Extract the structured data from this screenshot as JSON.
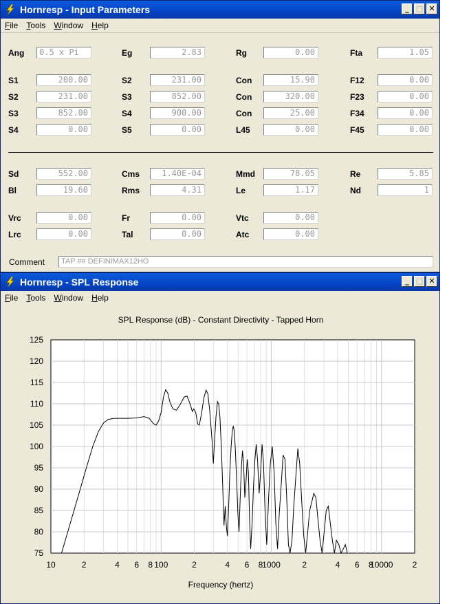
{
  "window1": {
    "title": "Hornresp - Input Parameters",
    "controls": {
      "minimize": "_",
      "maximize": "□",
      "close": "✕"
    },
    "menu": [
      "File",
      "Tools",
      "Window",
      "Help"
    ]
  },
  "params": {
    "ang": {
      "label": "Ang",
      "value": "0.5 x Pi"
    },
    "eg": {
      "label": "Eg",
      "value": "2.83"
    },
    "rg": {
      "label": "Rg",
      "value": "0.00"
    },
    "fta": {
      "label": "Fta",
      "value": "1.05"
    },
    "r1": [
      {
        "label": "S1",
        "value": "200.00"
      },
      {
        "label": "S2",
        "value": "231.00"
      },
      {
        "label": "Con",
        "value": "15.90"
      },
      {
        "label": "F12",
        "value": "0.00"
      }
    ],
    "r2": [
      {
        "label": "S2",
        "value": "231.00"
      },
      {
        "label": "S3",
        "value": "852.00"
      },
      {
        "label": "Con",
        "value": "320.00"
      },
      {
        "label": "F23",
        "value": "0.00"
      }
    ],
    "r3": [
      {
        "label": "S3",
        "value": "852.00"
      },
      {
        "label": "S4",
        "value": "900.00"
      },
      {
        "label": "Con",
        "value": "25.00"
      },
      {
        "label": "F34",
        "value": "0.00"
      }
    ],
    "r4": [
      {
        "label": "S4",
        "value": "0.00"
      },
      {
        "label": "S5",
        "value": "0.00"
      },
      {
        "label": "L45",
        "value": "0.00"
      },
      {
        "label": "F45",
        "value": "0.00"
      }
    ],
    "d1": [
      {
        "label": "Sd",
        "value": "552.00"
      },
      {
        "label": "Cms",
        "value": "1.40E-04"
      },
      {
        "label": "Mmd",
        "value": "78.05"
      },
      {
        "label": "Re",
        "value": "5.85"
      }
    ],
    "d2": [
      {
        "label": "Bl",
        "value": "19.60"
      },
      {
        "label": "Rms",
        "value": "4.31"
      },
      {
        "label": "Le",
        "value": "1.17"
      },
      {
        "label": "Nd",
        "value": "1"
      }
    ],
    "c1": [
      {
        "label": "Vrc",
        "value": "0.00"
      },
      {
        "label": "Fr",
        "value": "0.00"
      },
      {
        "label": "Vtc",
        "value": "0.00"
      }
    ],
    "c2": [
      {
        "label": "Lrc",
        "value": "0.00"
      },
      {
        "label": "Tal",
        "value": "0.00"
      },
      {
        "label": "Atc",
        "value": "0.00"
      }
    ],
    "comment": {
      "label": "Comment",
      "value": "TAP ## DEFINIMAX12HO"
    }
  },
  "window2": {
    "title": "Hornresp - SPL Response",
    "controls": {
      "minimize": "_",
      "maximize": "□",
      "close": "✕"
    },
    "menu": [
      "File",
      "Tools",
      "Window",
      "Help"
    ]
  },
  "chart_data": {
    "type": "line",
    "title": "SPL Response (dB) - Constant Directivity - Tapped Horn",
    "xlabel": "Frequency (hertz)",
    "ylabel": "",
    "xscale": "log",
    "xlim": [
      10,
      20000
    ],
    "ylim": [
      75,
      125
    ],
    "yticks": [
      75,
      80,
      85,
      90,
      95,
      100,
      105,
      110,
      115,
      120,
      125
    ],
    "xtick_labels": [
      {
        "v": 10,
        "t": "10"
      },
      {
        "v": 20,
        "t": "2"
      },
      {
        "v": 40,
        "t": "4"
      },
      {
        "v": 60,
        "t": "6"
      },
      {
        "v": 80,
        "t": "8"
      },
      {
        "v": 100,
        "t": "100"
      },
      {
        "v": 200,
        "t": "2"
      },
      {
        "v": 400,
        "t": "4"
      },
      {
        "v": 600,
        "t": "6"
      },
      {
        "v": 800,
        "t": "8"
      },
      {
        "v": 1000,
        "t": "1000"
      },
      {
        "v": 2000,
        "t": "2"
      },
      {
        "v": 4000,
        "t": "4"
      },
      {
        "v": 6000,
        "t": "6"
      },
      {
        "v": 8000,
        "t": "8"
      },
      {
        "v": 10000,
        "t": "10000"
      },
      {
        "v": 20000,
        "t": "2"
      }
    ],
    "grid": true,
    "series": [
      {
        "color": "#000000",
        "points": [
          [
            12.5,
            75
          ],
          [
            15,
            82
          ],
          [
            18,
            89
          ],
          [
            21,
            95
          ],
          [
            24,
            100
          ],
          [
            27,
            103.5
          ],
          [
            30,
            105.5
          ],
          [
            33,
            106.3
          ],
          [
            37,
            106.6
          ],
          [
            42,
            106.6
          ],
          [
            50,
            106.6
          ],
          [
            60,
            106.7
          ],
          [
            70,
            107
          ],
          [
            78,
            106.6
          ],
          [
            85,
            105.4
          ],
          [
            90,
            105
          ],
          [
            95,
            106
          ],
          [
            100,
            108
          ],
          [
            105,
            111.5
          ],
          [
            110,
            113.3
          ],
          [
            115,
            112.5
          ],
          [
            120,
            110.5
          ],
          [
            128,
            108.8
          ],
          [
            138,
            108.5
          ],
          [
            150,
            110
          ],
          [
            162,
            111.6
          ],
          [
            172,
            111.8
          ],
          [
            182,
            110.2
          ],
          [
            192,
            108.2
          ],
          [
            198,
            108.8
          ],
          [
            206,
            108
          ],
          [
            215,
            105.3
          ],
          [
            222,
            105
          ],
          [
            232,
            107.5
          ],
          [
            245,
            111.5
          ],
          [
            256,
            113.2
          ],
          [
            266,
            112.3
          ],
          [
            276,
            108.5
          ],
          [
            285,
            104
          ],
          [
            292,
            100.5
          ],
          [
            298,
            96
          ],
          [
            305,
            101
          ],
          [
            315,
            107
          ],
          [
            325,
            110.5
          ],
          [
            333,
            110
          ],
          [
            342,
            107
          ],
          [
            352,
            100
          ],
          [
            362,
            91
          ],
          [
            372,
            81.5
          ],
          [
            382,
            86
          ],
          [
            392,
            81
          ],
          [
            400,
            79
          ],
          [
            410,
            86
          ],
          [
            422,
            95
          ],
          [
            432,
            100
          ],
          [
            442,
            103.5
          ],
          [
            452,
            104.8
          ],
          [
            462,
            103.5
          ],
          [
            472,
            99
          ],
          [
            485,
            92
          ],
          [
            498,
            84
          ],
          [
            510,
            80
          ],
          [
            522,
            88
          ],
          [
            535,
            95
          ],
          [
            548,
            99
          ],
          [
            560,
            96
          ],
          [
            575,
            88
          ],
          [
            590,
            92
          ],
          [
            605,
            97
          ],
          [
            620,
            94
          ],
          [
            635,
            83
          ],
          [
            650,
            76
          ],
          [
            670,
            82
          ],
          [
            690,
            91
          ],
          [
            710,
            97
          ],
          [
            730,
            100.5
          ],
          [
            750,
            97
          ],
          [
            775,
            89
          ],
          [
            800,
            94
          ],
          [
            825,
            100.5
          ],
          [
            850,
            96
          ],
          [
            880,
            84
          ],
          [
            910,
            77
          ],
          [
            945,
            88
          ],
          [
            980,
            96
          ],
          [
            1020,
            100
          ],
          [
            1060,
            94
          ],
          [
            1100,
            82
          ],
          [
            1140,
            76
          ],
          [
            1180,
            84
          ],
          [
            1230,
            91
          ],
          [
            1280,
            98
          ],
          [
            1330,
            97
          ],
          [
            1380,
            88
          ],
          [
            1430,
            77
          ],
          [
            1480,
            75
          ],
          [
            1540,
            78
          ],
          [
            1600,
            86
          ],
          [
            1670,
            93
          ],
          [
            1740,
            99.5
          ],
          [
            1810,
            96
          ],
          [
            1890,
            87
          ],
          [
            1970,
            79
          ],
          [
            2050,
            75
          ],
          [
            2140,
            80
          ],
          [
            2230,
            85
          ],
          [
            2330,
            87
          ],
          [
            2430,
            89
          ],
          [
            2540,
            88
          ],
          [
            2650,
            83
          ],
          [
            2770,
            78
          ],
          [
            2890,
            75
          ],
          [
            3020,
            80
          ],
          [
            3150,
            85
          ],
          [
            3290,
            86
          ],
          [
            3430,
            82
          ],
          [
            3580,
            78
          ],
          [
            3740,
            75
          ],
          [
            3900,
            78
          ],
          [
            4100,
            77
          ],
          [
            4300,
            75
          ],
          [
            4500,
            76
          ],
          [
            4700,
            77
          ],
          [
            4900,
            75
          ]
        ]
      }
    ]
  }
}
